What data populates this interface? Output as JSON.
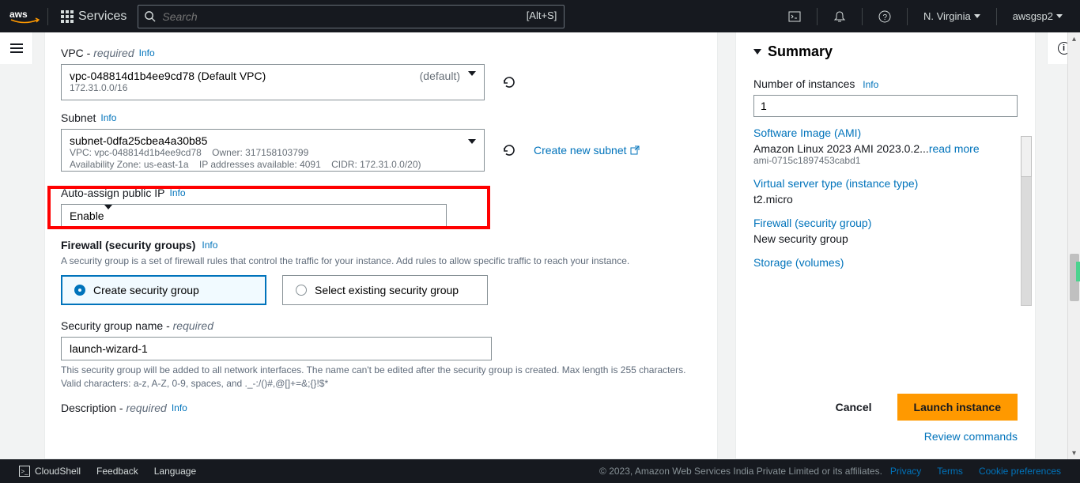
{
  "topnav": {
    "services": "Services",
    "search_placeholder": "Search",
    "search_hint": "[Alt+S]",
    "region": "N. Virginia",
    "account": "awsgsp2"
  },
  "form": {
    "vpc_label": "VPC - ",
    "vpc_required": "required",
    "vpc_value": "vpc-048814d1b4ee9cd78 (Default VPC)",
    "vpc_default": "(default)",
    "vpc_cidr": "172.31.0.0/16",
    "subnet_label": "Subnet",
    "subnet_value": "subnet-0dfa25cbea4a30b85",
    "subnet_vpc": "VPC: vpc-048814d1b4ee9cd78",
    "subnet_owner": "Owner: 317158103799",
    "subnet_az": "Availability Zone: us-east-1a",
    "subnet_ips": "IP addresses available: 4091",
    "subnet_cidr": "CIDR: 172.31.0.0/20)",
    "create_subnet": "Create new subnet",
    "auto_ip_label": "Auto-assign public IP",
    "auto_ip_value": "Enable",
    "firewall_label": "Firewall (security groups)",
    "firewall_help": "A security group is a set of firewall rules that control the traffic for your instance. Add rules to allow specific traffic to reach your instance.",
    "sg_create": "Create security group",
    "sg_select": "Select existing security group",
    "sg_name_label": "Security group name - ",
    "sg_name_required": "required",
    "sg_name_value": "launch-wizard-1",
    "sg_name_help": "This security group will be added to all network interfaces. The name can't be edited after the security group is created. Max length is 255 characters. Valid characters: a-z, A-Z, 0-9, spaces, and ._-:/()#,@[]+=&;{}!$*",
    "desc_label": "Description - ",
    "desc_required": "required",
    "info": "Info"
  },
  "summary": {
    "title": "Summary",
    "num_instances_label": "Number of instances",
    "num_instances_value": "1",
    "ami_link": "Software Image (AMI)",
    "ami_text": "Amazon Linux 2023 AMI 2023.0.2...",
    "read_more": "read more",
    "ami_id": "ami-0715c1897453cabd1",
    "instance_type_link": "Virtual server type (instance type)",
    "instance_type_text": "t2.micro",
    "firewall_link": "Firewall (security group)",
    "firewall_text": "New security group",
    "storage_link": "Storage (volumes)",
    "cancel": "Cancel",
    "launch": "Launch instance",
    "review": "Review commands"
  },
  "footer": {
    "cloudshell": "CloudShell",
    "feedback": "Feedback",
    "language": "Language",
    "copyright": "© 2023, Amazon Web Services India Private Limited or its affiliates.",
    "privacy": "Privacy",
    "terms": "Terms",
    "cookies": "Cookie preferences"
  }
}
